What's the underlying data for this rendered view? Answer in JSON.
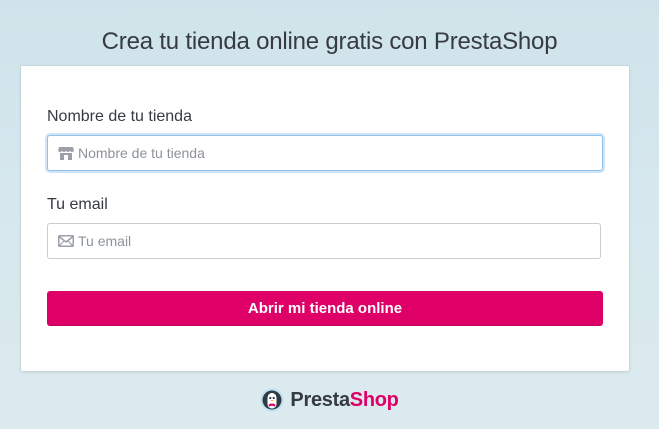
{
  "page": {
    "title": "Crea tu tienda online gratis con PrestaShop"
  },
  "form": {
    "store_name": {
      "label": "Nombre de tu tienda",
      "placeholder": "Nombre de tu tienda",
      "value": "",
      "icon": "store-icon"
    },
    "email": {
      "label": "Tu email",
      "placeholder": "Tu email",
      "value": "",
      "icon": "envelope-icon"
    },
    "submit_label": "Abrir mi tienda online"
  },
  "footer": {
    "logo_text_part1": "Presta",
    "logo_text_part2": "Shop",
    "logo_icon": "prestashop-penguin-icon"
  },
  "colors": {
    "accent": "#df0067",
    "focus_border": "#8fc3ec",
    "text": "#363a41",
    "background": "#d3e6ec"
  }
}
